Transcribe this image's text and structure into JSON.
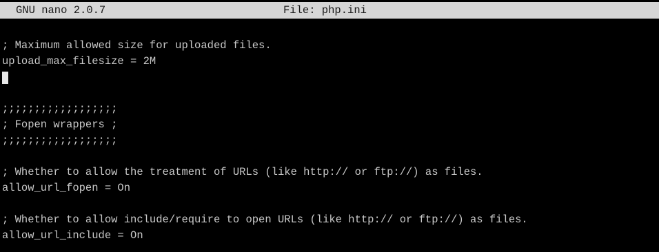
{
  "titlebar": {
    "version": "GNU nano 2.0.7",
    "file": "File: php.ini"
  },
  "buffer": {
    "lines": [
      "; Maximum allowed size for uploaded files.",
      "upload_max_filesize = 2M",
      "",
      "",
      ";;;;;;;;;;;;;;;;;;",
      "; Fopen wrappers ;",
      ";;;;;;;;;;;;;;;;;;",
      "",
      "; Whether to allow the treatment of URLs (like http:// or ftp://) as files.",
      "allow_url_fopen = On",
      "",
      "; Whether to allow include/require to open URLs (like http:// or ftp://) as files.",
      "allow_url_include = On"
    ]
  }
}
